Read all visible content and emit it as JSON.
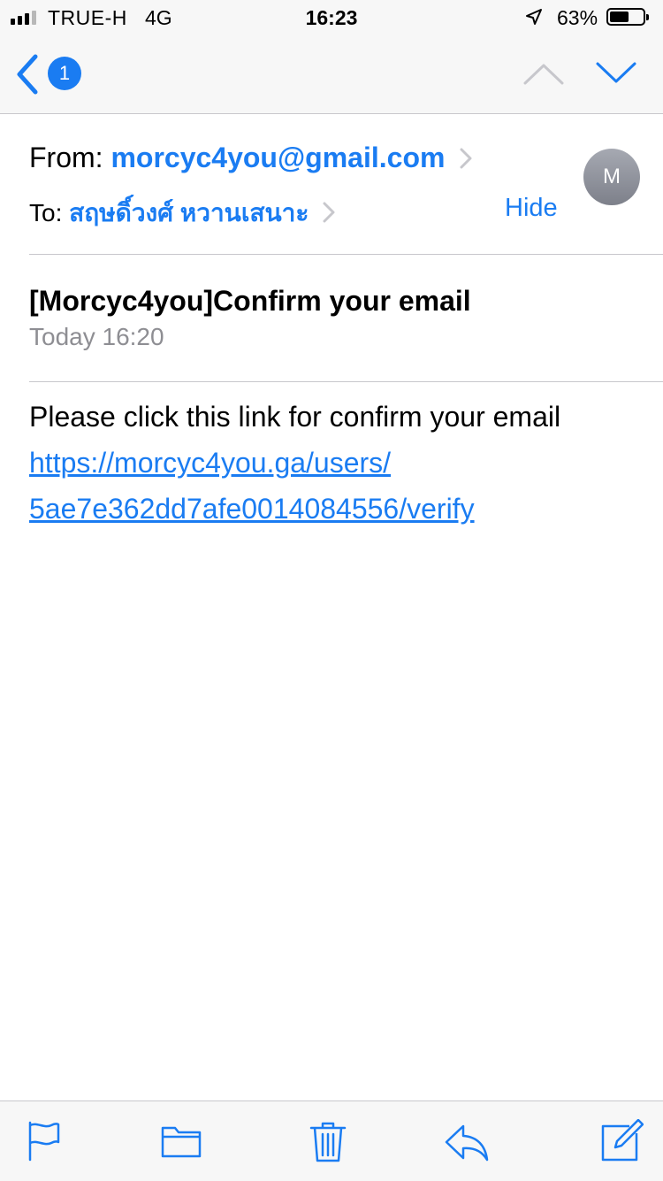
{
  "status_bar": {
    "carrier": "TRUE-H",
    "network": "4G",
    "time": "16:23",
    "battery_percent": "63%",
    "battery_level": 0.63,
    "signal_bars": 3,
    "icons": [
      "signal-icon",
      "location-arrow-icon",
      "battery-icon"
    ]
  },
  "nav": {
    "unread_count": "1",
    "icons": [
      "back-chevron-icon",
      "chevron-up-icon",
      "chevron-down-icon"
    ]
  },
  "header": {
    "from_label": "From:",
    "from_address": "morcyc4you@gmail.com",
    "to_label": "To:",
    "to_name": "สฤษดิ์วงศ์ หวานเสนาะ",
    "hide_label": "Hide",
    "avatar_initial": "M"
  },
  "message": {
    "subject": "[Morcyc4you]Confirm your email",
    "date": "Today 16:20",
    "body": "Please click this link for confirm your email",
    "link_line1": "https://morcyc4you.ga/users/",
    "link_line2": "5ae7e362dd7afe0014084556/verify"
  },
  "toolbar": {
    "icons": [
      "flag-icon",
      "folder-icon",
      "trash-icon",
      "reply-icon",
      "compose-icon"
    ]
  },
  "colors": {
    "accent": "#1a7cf2",
    "secondary_text": "#8e8e93",
    "bar_background": "#f7f7f7",
    "separator": "#c8c7cc"
  }
}
